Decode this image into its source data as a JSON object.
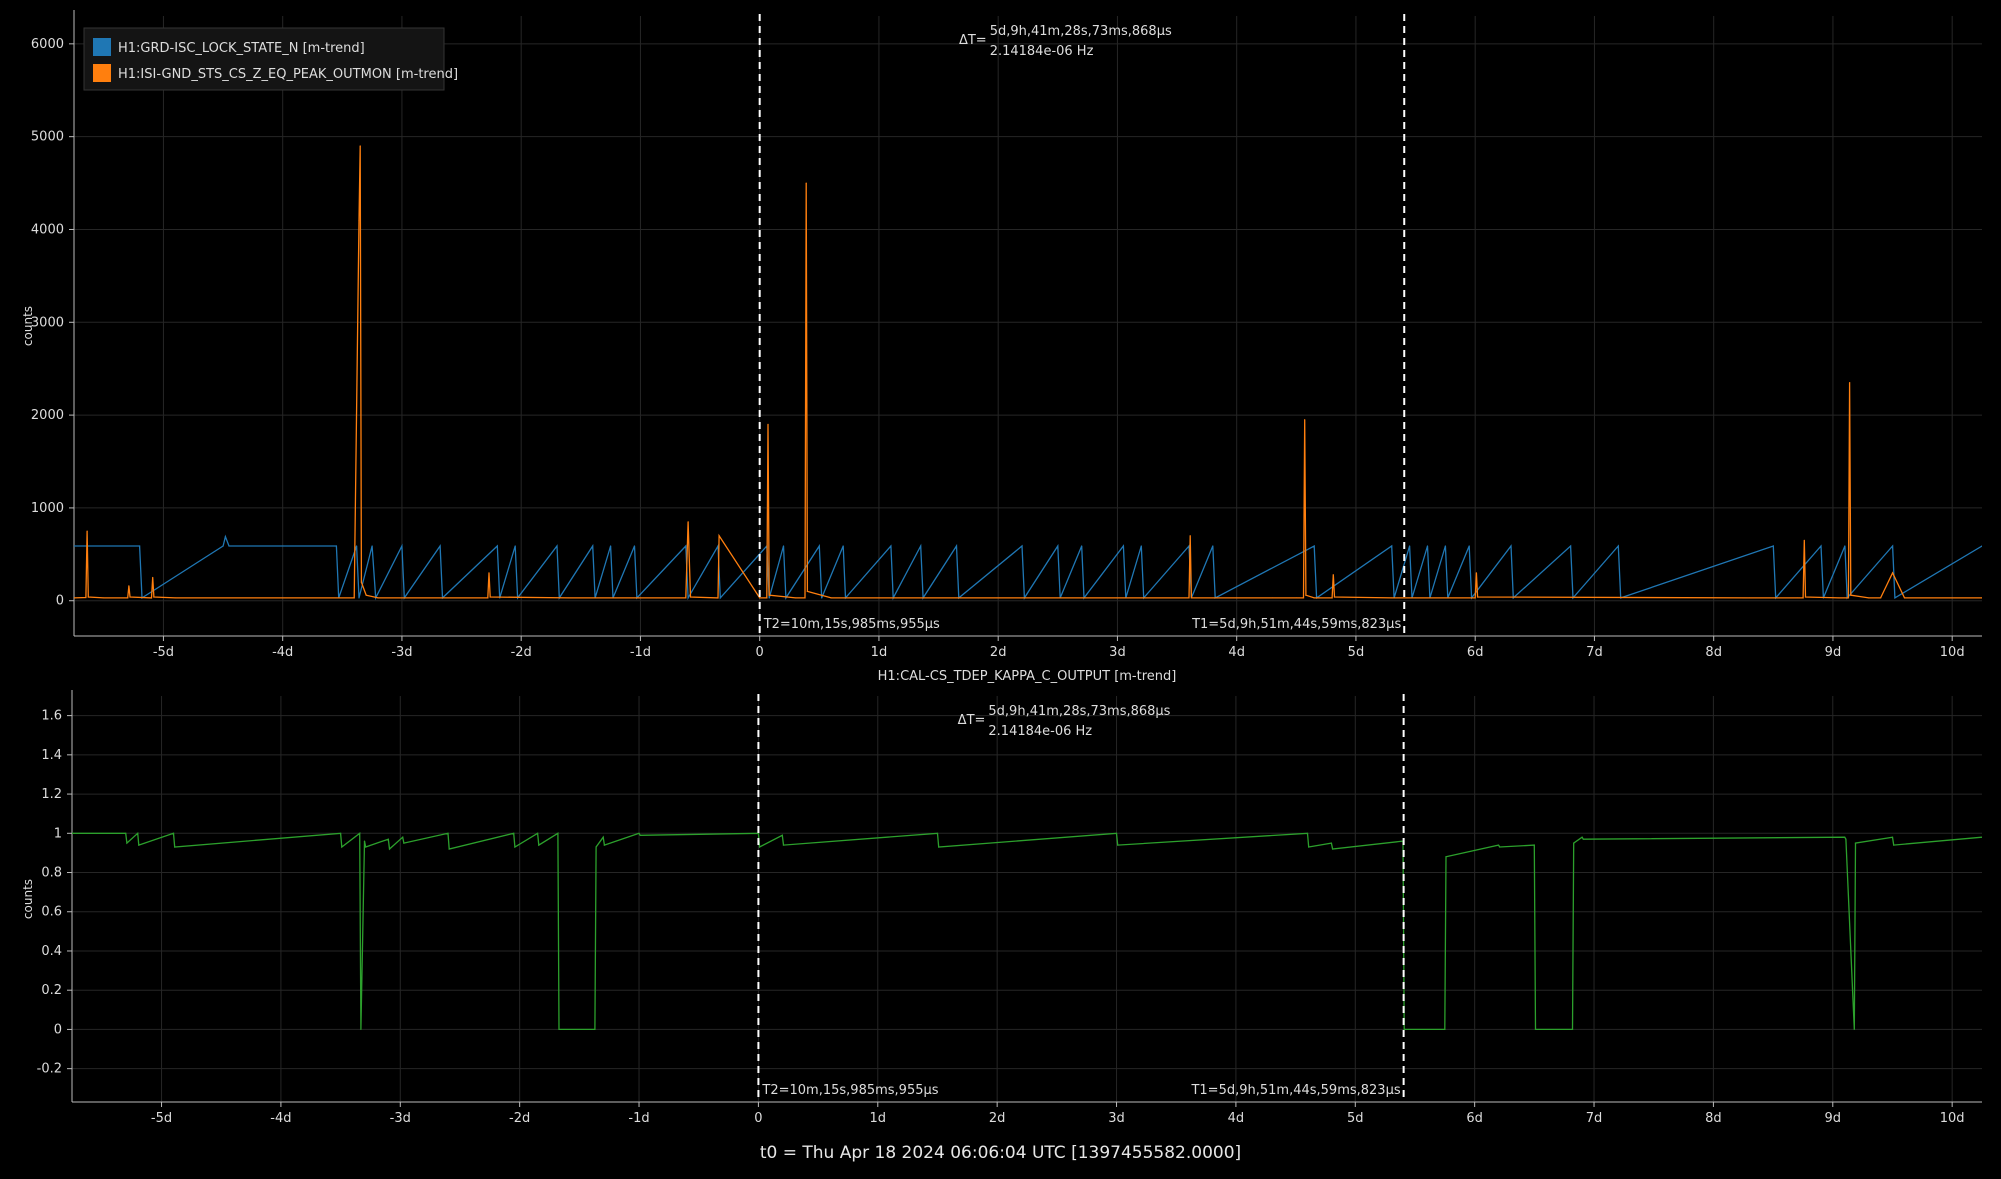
{
  "footer": {
    "t0_label": "t0 = Thu Apr 18 2024 06:06:04 UTC [1397455582.0000]"
  },
  "chart_data": [
    {
      "type": "line",
      "title": "",
      "ylabel": "counts",
      "xlim": [
        -5.75,
        10.25
      ],
      "ylim": [
        -380,
        6300
      ],
      "x_ticks": [
        -5,
        -4,
        -3,
        -2,
        -1,
        0,
        1,
        2,
        3,
        4,
        5,
        6,
        7,
        8,
        9,
        10
      ],
      "x_tick_labels": [
        "-5d",
        "-4d",
        "-3d",
        "-2d",
        "-1d",
        "0",
        "1d",
        "2d",
        "3d",
        "4d",
        "5d",
        "6d",
        "7d",
        "8d",
        "9d",
        "10d"
      ],
      "y_ticks": [
        0,
        1000,
        2000,
        3000,
        4000,
        5000,
        6000
      ],
      "y_tick_labels": [
        "0",
        "1000",
        "2000",
        "3000",
        "4000",
        "5000",
        "6000"
      ],
      "grid": true,
      "legend_position": "top-left",
      "series": [
        {
          "name": "H1:GRD-ISC_LOCK_STATE_N [m-trend]",
          "color": "#1f77b4",
          "x": [
            -5.75,
            -5.2,
            -5.18,
            -4.5,
            -4.48,
            -4.45,
            -3.55,
            -3.53,
            -3.38,
            -3.36,
            -3.25,
            -3.22,
            -3.0,
            -2.98,
            -2.68,
            -2.66,
            -2.2,
            -2.18,
            -2.05,
            -2.03,
            -1.7,
            -1.68,
            -1.4,
            -1.38,
            -1.25,
            -1.23,
            -1.05,
            -1.03,
            -0.62,
            -0.6,
            -0.35,
            -0.33,
            0.06,
            0.08,
            0.2,
            0.22,
            0.5,
            0.52,
            0.7,
            0.72,
            1.1,
            1.12,
            1.35,
            1.37,
            1.65,
            1.67,
            2.2,
            2.22,
            2.5,
            2.52,
            2.7,
            2.72,
            3.05,
            3.07,
            3.2,
            3.22,
            3.6,
            3.62,
            3.8,
            3.82,
            4.65,
            4.67,
            5.3,
            5.32,
            5.45,
            5.47,
            5.6,
            5.62,
            5.75,
            5.77,
            5.95,
            5.97,
            6.3,
            6.32,
            6.8,
            6.82,
            7.2,
            7.22,
            8.5,
            8.52,
            8.9,
            8.92,
            9.1,
            9.12,
            9.5,
            9.52,
            10.25
          ],
          "y": [
            590,
            590,
            30,
            590,
            690,
            590,
            590,
            30,
            590,
            30,
            590,
            30,
            590,
            30,
            590,
            30,
            590,
            30,
            590,
            30,
            590,
            30,
            590,
            30,
            590,
            30,
            590,
            30,
            590,
            30,
            590,
            30,
            590,
            30,
            590,
            30,
            590,
            30,
            590,
            30,
            590,
            30,
            590,
            30,
            590,
            30,
            590,
            30,
            590,
            30,
            590,
            30,
            590,
            30,
            590,
            30,
            590,
            30,
            590,
            30,
            590,
            30,
            590,
            30,
            590,
            30,
            590,
            30,
            590,
            30,
            590,
            30,
            590,
            30,
            590,
            30,
            590,
            30,
            590,
            30,
            590,
            30,
            590,
            30,
            590,
            30,
            590
          ]
        },
        {
          "name": "H1:ISI-GND_STS_CS_Z_EQ_PEAK_OUTMON [m-trend]",
          "color": "#ff7f0e",
          "x": [
            -5.75,
            -5.65,
            -5.64,
            -5.63,
            -5.5,
            -5.3,
            -5.29,
            -5.28,
            -5.1,
            -5.09,
            -5.08,
            -4.9,
            -3.4,
            -3.36,
            -3.35,
            -3.34,
            -3.3,
            -3.2,
            -2.28,
            -2.27,
            -2.26,
            -1.6,
            -0.62,
            -0.6,
            -0.58,
            -0.35,
            -0.34,
            0.0,
            0.06,
            0.07,
            0.08,
            0.3,
            0.38,
            0.39,
            0.4,
            0.6,
            1.0,
            3.6,
            3.61,
            3.62,
            4.3,
            4.5,
            4.56,
            4.57,
            4.58,
            4.65,
            4.8,
            4.81,
            4.82,
            5.3,
            5.4,
            5.5,
            6.0,
            6.01,
            6.02,
            8.3,
            8.7,
            8.75,
            8.76,
            8.77,
            9.05,
            9.13,
            9.14,
            9.15,
            9.3,
            9.4,
            9.5,
            9.6,
            10.25
          ],
          "y": [
            30,
            35,
            750,
            40,
            30,
            30,
            160,
            40,
            30,
            250,
            40,
            30,
            30,
            4100,
            4900,
            200,
            60,
            30,
            30,
            300,
            40,
            30,
            30,
            850,
            40,
            30,
            700,
            30,
            30,
            1900,
            60,
            30,
            30,
            4500,
            100,
            30,
            30,
            30,
            700,
            30,
            30,
            30,
            30,
            1950,
            60,
            30,
            30,
            280,
            40,
            30,
            30,
            30,
            30,
            300,
            40,
            30,
            30,
            30,
            650,
            40,
            30,
            30,
            2350,
            60,
            30,
            30,
            300,
            30,
            30
          ]
        }
      ],
      "cursors": [
        {
          "x": 0.0,
          "label": "T2=10m,15s,985ms,955µs"
        },
        {
          "x": 5.405,
          "label": "T1=5d,9h,51m,44s,59ms,823µs"
        }
      ],
      "delta": {
        "prefix": "ΔT=",
        "line1": "5d,9h,41m,28s,73ms,868µs",
        "line2": "2.14184e-06 Hz"
      }
    },
    {
      "type": "line",
      "title": "H1:CAL-CS_TDEP_KAPPA_C_OUTPUT [m-trend]",
      "ylabel": "counts",
      "xlim": [
        -5.75,
        10.25
      ],
      "ylim": [
        -0.37,
        1.7
      ],
      "x_ticks": [
        -5,
        -4,
        -3,
        -2,
        -1,
        0,
        1,
        2,
        3,
        4,
        5,
        6,
        7,
        8,
        9,
        10
      ],
      "x_tick_labels": [
        "-5d",
        "-4d",
        "-3d",
        "-2d",
        "-1d",
        "0",
        "1d",
        "2d",
        "3d",
        "4d",
        "5d",
        "6d",
        "7d",
        "8d",
        "9d",
        "10d"
      ],
      "y_ticks": [
        -0.2,
        0,
        0.2,
        0.4,
        0.6,
        0.8,
        1,
        1.2,
        1.4,
        1.6
      ],
      "y_tick_labels": [
        "-0.2",
        "0",
        "0.2",
        "0.4",
        "0.6",
        "0.8",
        "1",
        "1.2",
        "1.4",
        "1.6"
      ],
      "grid": true,
      "series": [
        {
          "name": "",
          "color": "#2ca02c",
          "x": [
            -5.75,
            -5.3,
            -5.29,
            -5.2,
            -5.19,
            -4.9,
            -4.89,
            -3.5,
            -3.49,
            -3.34,
            -3.33,
            -3.3,
            -3.29,
            -3.1,
            -3.09,
            -2.98,
            -2.97,
            -2.6,
            -2.59,
            -2.05,
            -2.04,
            -1.85,
            -1.84,
            -1.68,
            -1.67,
            -1.37,
            -1.36,
            -1.3,
            -1.29,
            -1.0,
            -0.99,
            0.0,
            0.01,
            0.2,
            0.21,
            1.5,
            1.51,
            3.0,
            3.01,
            4.6,
            4.61,
            4.8,
            4.81,
            5.4,
            5.41,
            5.75,
            5.76,
            6.2,
            6.21,
            6.5,
            6.51,
            6.82,
            6.83,
            6.9,
            6.91,
            9.1,
            9.11,
            9.18,
            9.19,
            9.5,
            9.51,
            10.25
          ],
          "y": [
            1.0,
            1.0,
            0.95,
            1.0,
            0.94,
            1.0,
            0.93,
            1.0,
            0.93,
            1.0,
            0.0,
            0.96,
            0.93,
            0.97,
            0.92,
            0.98,
            0.95,
            1.0,
            0.92,
            1.0,
            0.93,
            1.0,
            0.94,
            1.0,
            0.0,
            0.0,
            0.93,
            0.98,
            0.94,
            1.0,
            0.99,
            1.0,
            0.93,
            0.99,
            0.94,
            1.0,
            0.93,
            1.0,
            0.94,
            1.0,
            0.93,
            0.95,
            0.92,
            0.96,
            0.0,
            0.0,
            0.88,
            0.94,
            0.93,
            0.94,
            0.0,
            0.0,
            0.95,
            0.98,
            0.97,
            0.98,
            0.97,
            0.0,
            0.95,
            0.98,
            0.94,
            0.98
          ]
        }
      ],
      "cursors": [
        {
          "x": 0.0,
          "label": "T2=10m,15s,985ms,955µs"
        },
        {
          "x": 5.405,
          "label": "T1=5d,9h,51m,44s,59ms,823µs"
        }
      ],
      "delta": {
        "prefix": "ΔT=",
        "line1": "5d,9h,41m,28s,73ms,868µs",
        "line2": "2.14184e-06 Hz"
      }
    }
  ]
}
